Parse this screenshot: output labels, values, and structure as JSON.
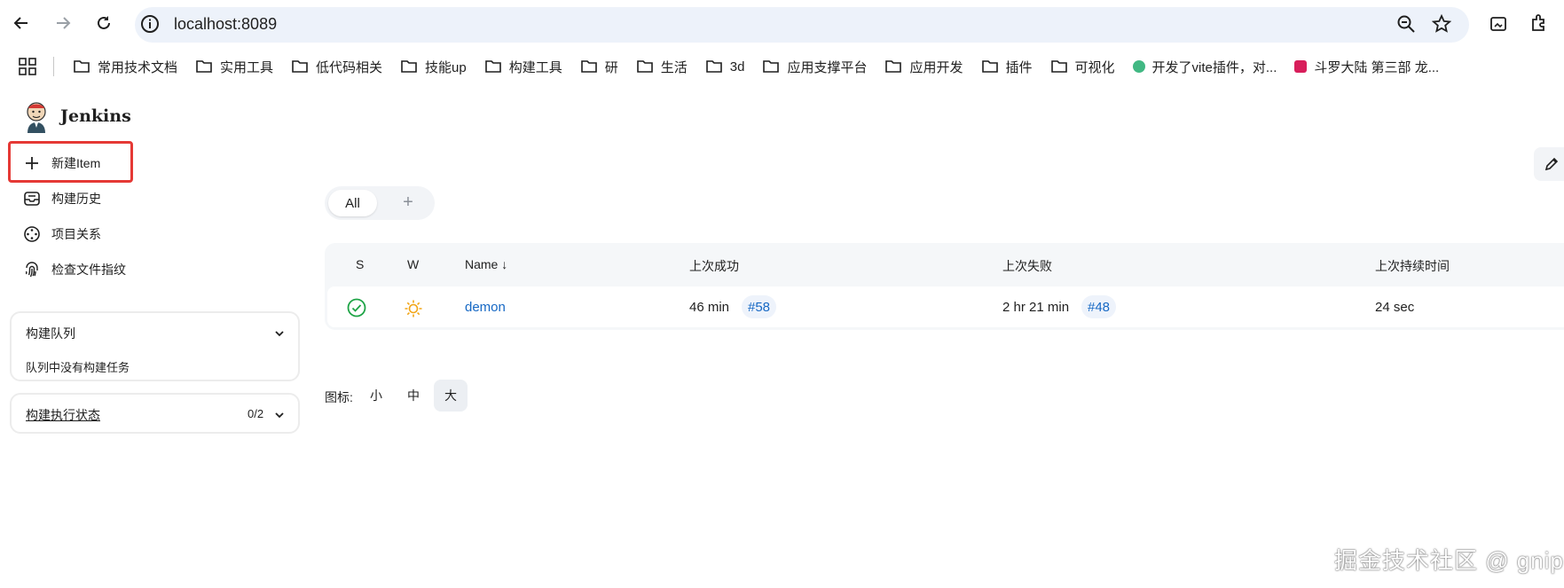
{
  "browser": {
    "url": "localhost:8089",
    "bookmarks": [
      {
        "label": "常用技术文档",
        "icon": "folder-icon"
      },
      {
        "label": "实用工具",
        "icon": "folder-icon"
      },
      {
        "label": "低代码相关",
        "icon": "folder-icon"
      },
      {
        "label": "技能up",
        "icon": "folder-icon"
      },
      {
        "label": "构建工具",
        "icon": "folder-icon"
      },
      {
        "label": "研",
        "icon": "folder-icon"
      },
      {
        "label": "生活",
        "icon": "folder-icon"
      },
      {
        "label": "3d",
        "icon": "folder-icon"
      },
      {
        "label": "应用支撑平台",
        "icon": "folder-icon"
      },
      {
        "label": "应用开发",
        "icon": "folder-icon"
      },
      {
        "label": "插件",
        "icon": "folder-icon"
      },
      {
        "label": "可视化",
        "icon": "folder-icon"
      },
      {
        "label": "开发了vite插件，对...",
        "icon": "vite-favicon",
        "color": "#41b883"
      },
      {
        "label": "斗罗大陆 第三部 龙...",
        "icon": "jing-favicon",
        "color": "#d81e5b"
      }
    ]
  },
  "app": {
    "brand": "Jenkins",
    "sidebar": [
      {
        "label": "新建Item",
        "icon": "plus-icon"
      },
      {
        "label": "构建历史",
        "icon": "history-icon"
      },
      {
        "label": "项目关系",
        "icon": "relation-icon"
      },
      {
        "label": "检查文件指纹",
        "icon": "fingerprint-icon"
      }
    ],
    "queue": {
      "title": "构建队列",
      "empty": "队列中没有构建任务"
    },
    "executors": {
      "title": "构建执行状态",
      "count": "0/2"
    }
  },
  "views": {
    "tabs": [
      {
        "label": "All"
      }
    ],
    "add": "+"
  },
  "table": {
    "headers": {
      "s": "S",
      "w": "W",
      "name": "Name ↓",
      "last_success": "上次成功",
      "last_failure": "上次失败",
      "last_duration": "上次持续时间"
    },
    "rows": [
      {
        "name": "demon",
        "last_success": "46 min",
        "success_build": "#58",
        "last_failure": "2 hr 21 min",
        "failure_build": "#48",
        "duration": "24 sec"
      }
    ]
  },
  "icon_size": {
    "label": "图标:",
    "options": [
      "小",
      "中",
      "大"
    ],
    "selected": "大"
  },
  "watermark": "掘金技术社区 @ gnip",
  "colors": {
    "accent": "#1668c4",
    "success": "#1ea446",
    "weather": "#f2a516",
    "highlight": "#e53935"
  }
}
